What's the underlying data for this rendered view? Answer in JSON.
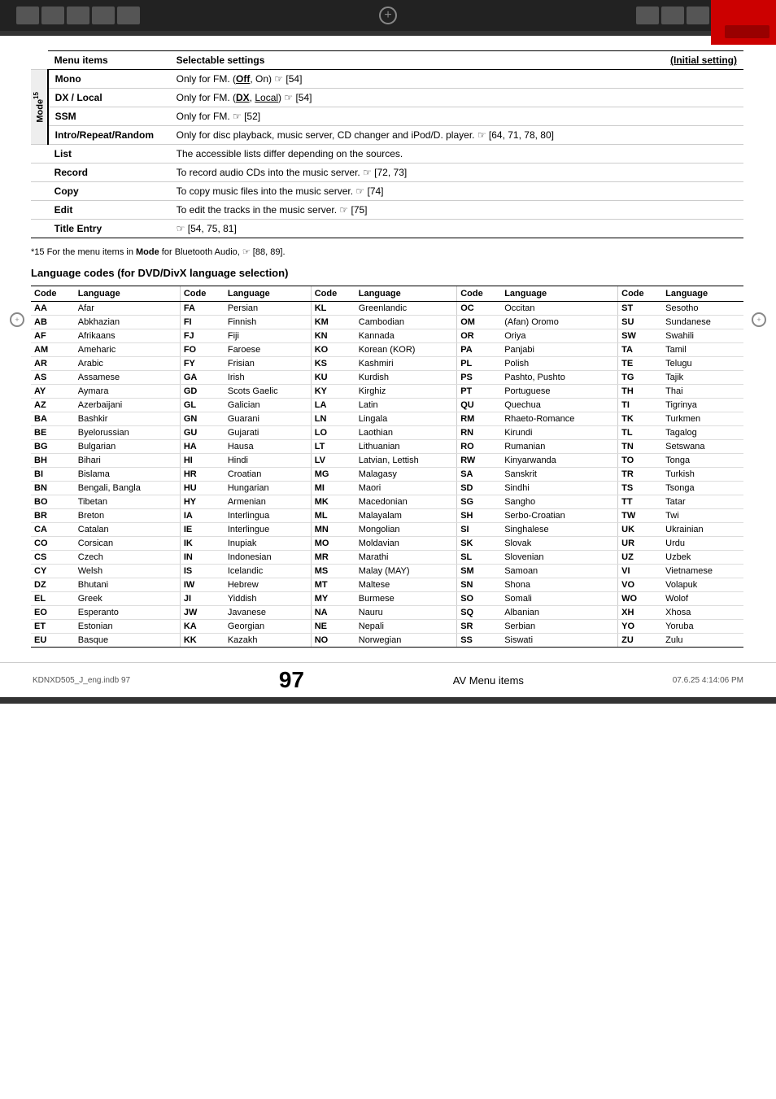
{
  "header": {
    "title": "AV Menu items"
  },
  "top_bar_blocks": [
    "block1",
    "block2",
    "block3",
    "block4",
    "block5"
  ],
  "right_bar_blocks": [
    "block1",
    "block2",
    "block3",
    "block4",
    "block5"
  ],
  "menu_table": {
    "headers": [
      "Menu items",
      "Selectable settings",
      "(Initial setting)"
    ],
    "mode_label": "Mode",
    "mode_superscript": "15",
    "rows": [
      {
        "sub_label": "Mono",
        "selectable": "Only for FM. (Off, On) ☞ [54]",
        "is_mode": true
      },
      {
        "sub_label": "DX / Local",
        "selectable": "Only for FM. (DX, Local) ☞ [54]",
        "is_mode": true
      },
      {
        "sub_label": "SSM",
        "selectable": "Only for FM. ☞ [52]",
        "is_mode": true
      },
      {
        "sub_label": "Intro/Repeat/Random",
        "selectable": "Only for disc playback, music server, CD changer and iPod/D. player. ☞ [64, 71, 78, 80]",
        "is_mode": true
      },
      {
        "label": "List",
        "selectable": "The accessible lists differ depending on the sources.",
        "is_mode": false
      },
      {
        "label": "Record",
        "selectable": "To record audio CDs into the music server. ☞ [72, 73]",
        "is_mode": false
      },
      {
        "label": "Copy",
        "selectable": "To copy music files into the music server. ☞ [74]",
        "is_mode": false
      },
      {
        "label": "Edit",
        "selectable": "To edit the tracks in the music server. ☞ [75]",
        "is_mode": false
      },
      {
        "label": "Title Entry",
        "selectable": "☞ [54, 75, 81]",
        "is_mode": false
      }
    ]
  },
  "footnote": "*15 For the menu items in Mode for Bluetooth Audio, ☞ [88, 89].",
  "lang_section": {
    "title": "Language codes (for DVD/DivX language selection)",
    "column_headers": [
      "Code",
      "Language",
      "Code",
      "Language",
      "Code",
      "Language",
      "Code",
      "Language",
      "Code",
      "Language"
    ],
    "entries": [
      [
        "AA",
        "Afar",
        "FA",
        "Persian",
        "KL",
        "Greenlandic",
        "OC",
        "Occitan",
        "ST",
        "Sesotho"
      ],
      [
        "AB",
        "Abkhazian",
        "FI",
        "Finnish",
        "KM",
        "Cambodian",
        "OM",
        "(Afan) Oromo",
        "SU",
        "Sundanese"
      ],
      [
        "AF",
        "Afrikaans",
        "FJ",
        "Fiji",
        "KN",
        "Kannada",
        "OR",
        "Oriya",
        "SW",
        "Swahili"
      ],
      [
        "AM",
        "Ameharic",
        "FO",
        "Faroese",
        "KO",
        "Korean (KOR)",
        "PA",
        "Panjabi",
        "TA",
        "Tamil"
      ],
      [
        "AR",
        "Arabic",
        "FY",
        "Frisian",
        "KS",
        "Kashmiri",
        "PL",
        "Polish",
        "TE",
        "Telugu"
      ],
      [
        "AS",
        "Assamese",
        "GA",
        "Irish",
        "KU",
        "Kurdish",
        "PS",
        "Pashto, Pushto",
        "TG",
        "Tajik"
      ],
      [
        "AY",
        "Aymara",
        "GD",
        "Scots Gaelic",
        "KY",
        "Kirghiz",
        "PT",
        "Portuguese",
        "TH",
        "Thai"
      ],
      [
        "AZ",
        "Azerbaijani",
        "GL",
        "Galician",
        "LA",
        "Latin",
        "QU",
        "Quechua",
        "TI",
        "Tigrinya"
      ],
      [
        "BA",
        "Bashkir",
        "GN",
        "Guarani",
        "LN",
        "Lingala",
        "RM",
        "Rhaeto-Romance",
        "TK",
        "Turkmen"
      ],
      [
        "BE",
        "Byelorussian",
        "GU",
        "Gujarati",
        "LO",
        "Laothian",
        "RN",
        "Kirundi",
        "TL",
        "Tagalog"
      ],
      [
        "BG",
        "Bulgarian",
        "HA",
        "Hausa",
        "LT",
        "Lithuanian",
        "RO",
        "Rumanian",
        "TN",
        "Setswana"
      ],
      [
        "BH",
        "Bihari",
        "HI",
        "Hindi",
        "LV",
        "Latvian, Lettish",
        "RW",
        "Kinyarwanda",
        "TO",
        "Tonga"
      ],
      [
        "BI",
        "Bislama",
        "HR",
        "Croatian",
        "MG",
        "Malagasy",
        "SA",
        "Sanskrit",
        "TR",
        "Turkish"
      ],
      [
        "BN",
        "Bengali, Bangla",
        "HU",
        "Hungarian",
        "MI",
        "Maori",
        "SD",
        "Sindhi",
        "TS",
        "Tsonga"
      ],
      [
        "BO",
        "Tibetan",
        "HY",
        "Armenian",
        "MK",
        "Macedonian",
        "SG",
        "Sangho",
        "TT",
        "Tatar"
      ],
      [
        "BR",
        "Breton",
        "IA",
        "Interlingua",
        "ML",
        "Malayalam",
        "SH",
        "Serbo-Croatian",
        "TW",
        "Twi"
      ],
      [
        "CA",
        "Catalan",
        "IE",
        "Interlingue",
        "MN",
        "Mongolian",
        "SI",
        "Singhalese",
        "UK",
        "Ukrainian"
      ],
      [
        "CO",
        "Corsican",
        "IK",
        "Inupiak",
        "MO",
        "Moldavian",
        "SK",
        "Slovak",
        "UR",
        "Urdu"
      ],
      [
        "CS",
        "Czech",
        "IN",
        "Indonesian",
        "MR",
        "Marathi",
        "SL",
        "Slovenian",
        "UZ",
        "Uzbek"
      ],
      [
        "CY",
        "Welsh",
        "IS",
        "Icelandic",
        "MS",
        "Malay (MAY)",
        "SM",
        "Samoan",
        "VI",
        "Vietnamese"
      ],
      [
        "DZ",
        "Bhutani",
        "IW",
        "Hebrew",
        "MT",
        "Maltese",
        "SN",
        "Shona",
        "VO",
        "Volapuk"
      ],
      [
        "EL",
        "Greek",
        "JI",
        "Yiddish",
        "MY",
        "Burmese",
        "SO",
        "Somali",
        "WO",
        "Wolof"
      ],
      [
        "EO",
        "Esperanto",
        "JW",
        "Javanese",
        "NA",
        "Nauru",
        "SQ",
        "Albanian",
        "XH",
        "Xhosa"
      ],
      [
        "ET",
        "Estonian",
        "KA",
        "Georgian",
        "NE",
        "Nepali",
        "SR",
        "Serbian",
        "YO",
        "Yoruba"
      ],
      [
        "EU",
        "Basque",
        "KK",
        "Kazakh",
        "NO",
        "Norwegian",
        "SS",
        "Siswati",
        "ZU",
        "Zulu"
      ]
    ]
  },
  "footer": {
    "file_info": "KDNXD505_J_eng.indb  97",
    "date_info": "07.6.25  4:14:06 PM",
    "page_label": "AV Menu items",
    "page_number": "97"
  }
}
